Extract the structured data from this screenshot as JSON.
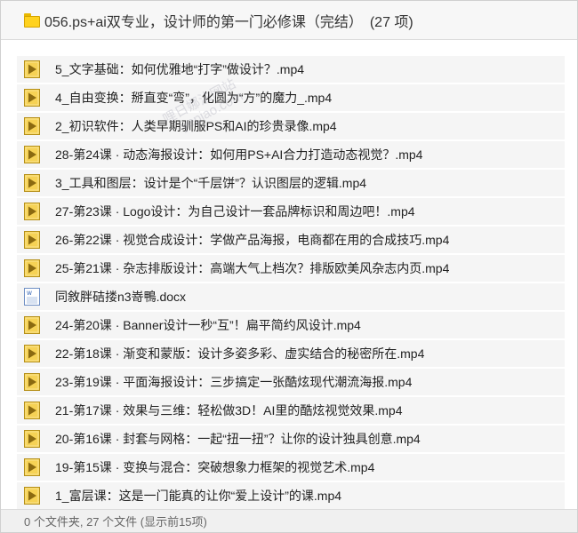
{
  "header": {
    "title": "056.ps+ai双专业，设计师的第一门必修课（完结）",
    "count": "(27 项)"
  },
  "files": [
    {
      "name": "5_文字基础：如何优雅地“打字”做设计？.mp4",
      "icon": "video-icon"
    },
    {
      "name": "4_自由变换：掰直变“弯”，化圆为“方”的魔力_.mp4",
      "icon": "video-icon"
    },
    {
      "name": "2_初识软件：人类早期驯服PS和AI的珍贵录像.mp4",
      "icon": "video-icon"
    },
    {
      "name": "28-第24课 · 动态海报设计：如何用PS+AI合力打造动态视觉？.mp4",
      "icon": "video-icon"
    },
    {
      "name": "3_工具和图层：设计是个“千层饼”？认识图层的逻辑.mp4",
      "icon": "video-icon"
    },
    {
      "name": "27-第23课 · Logo设计：为自己设计一套品牌标识和周边吧！.mp4",
      "icon": "video-icon"
    },
    {
      "name": "26-第22课 · 视觉合成设计：学做产品海报，电商都在用的合成技巧.mp4",
      "icon": "video-icon"
    },
    {
      "name": "25-第21课 · 杂志排版设计：高端大气上档次？排版欧美风杂志内页.mp4",
      "icon": "video-icon"
    },
    {
      "name": "同敘胖硈搂n3嵜鴨.docx",
      "icon": "word-doc-icon"
    },
    {
      "name": "24-第20课 · Banner设计一秒“互”！扁平简约风设计.mp4",
      "icon": "video-icon"
    },
    {
      "name": "22-第18课 · 渐变和蒙版：设计多姿多彩、虚实结合的秘密所在.mp4",
      "icon": "video-icon"
    },
    {
      "name": "23-第19课 · 平面海报设计：三步搞定一张酷炫现代潮流海报.mp4",
      "icon": "video-icon"
    },
    {
      "name": "21-第17课 · 效果与三维：轻松做3D！AI里的酷炫视觉效果.mp4",
      "icon": "video-icon"
    },
    {
      "name": "20-第16课 · 封套与网格：一起“扭一扭”？让你的设计独具创意.mp4",
      "icon": "video-icon"
    },
    {
      "name": "19-第15课 · 变换与混合：突破想象力框架的视觉艺术.mp4",
      "icon": "video-icon"
    },
    {
      "name": "1_富层课：这是一门能真的让你“爱上设计”的课.mp4",
      "icon": "video-icon"
    }
  ],
  "footer": {
    "status": "0 个文件夹, 27 个文件 (显示前15项)"
  },
  "watermark": {
    "line1": "哩日娜沾网站",
    "line2": "yepiao.com"
  },
  "colors": {
    "video_icon_fill": "#f6d255",
    "video_icon_border": "#b58f18",
    "play_triangle": "#8b6a10",
    "row_background": "#f5f5f5",
    "header_background": "#f7f7f7",
    "footer_background": "#f0f0f0"
  }
}
